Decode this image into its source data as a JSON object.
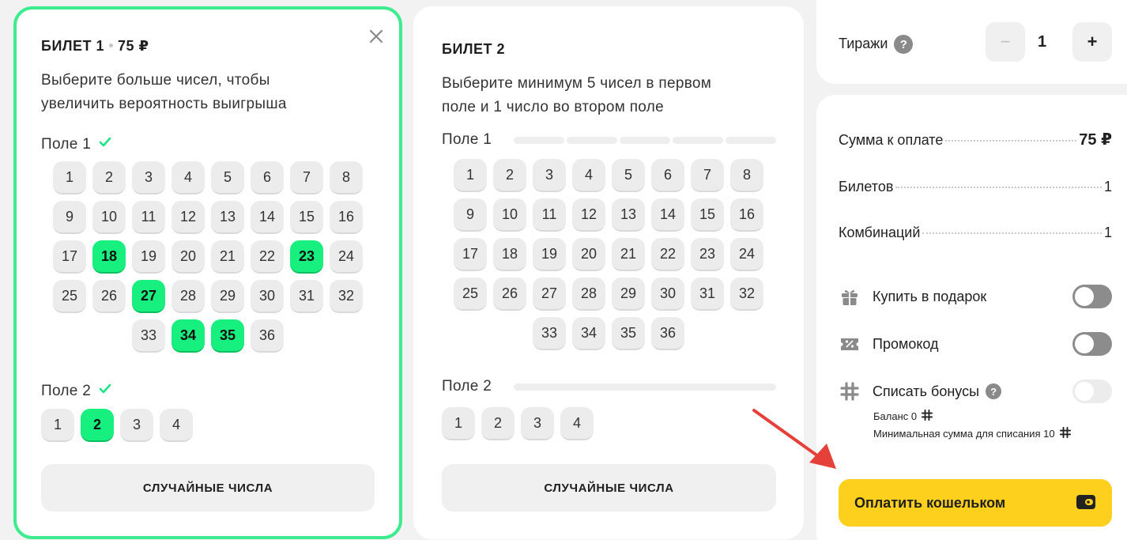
{
  "ticket1": {
    "title": "БИЛЕТ 1",
    "price": "75 ₽",
    "description": "Выберите больше чисел, чтобы увеличить вероятность выигрыша",
    "field1_label": "Поле 1",
    "field2_label": "Поле 2",
    "field1_numbers": [
      "1",
      "2",
      "3",
      "4",
      "5",
      "6",
      "7",
      "8",
      "9",
      "10",
      "11",
      "12",
      "13",
      "14",
      "15",
      "16",
      "17",
      "18",
      "19",
      "20",
      "21",
      "22",
      "23",
      "24",
      "25",
      "26",
      "27",
      "28",
      "29",
      "30",
      "31",
      "32",
      "33",
      "34",
      "35",
      "36"
    ],
    "field1_selected": [
      "18",
      "23",
      "27",
      "34",
      "35"
    ],
    "field2_numbers": [
      "1",
      "2",
      "3",
      "4"
    ],
    "field2_selected": [
      "2"
    ],
    "random_button": "СЛУЧАЙНЫЕ ЧИСЛА"
  },
  "ticket2": {
    "title": "БИЛЕТ 2",
    "description": "Выберите минимум 5 чисел в первом поле и 1 число во втором поле",
    "field1_label": "Поле 1",
    "field2_label": "Поле 2",
    "field1_numbers": [
      "1",
      "2",
      "3",
      "4",
      "5",
      "6",
      "7",
      "8",
      "9",
      "10",
      "11",
      "12",
      "13",
      "14",
      "15",
      "16",
      "17",
      "18",
      "19",
      "20",
      "21",
      "22",
      "23",
      "24",
      "25",
      "26",
      "27",
      "28",
      "29",
      "30",
      "31",
      "32",
      "33",
      "34",
      "35",
      "36"
    ],
    "field1_selected": [],
    "field2_numbers": [
      "1",
      "2",
      "3",
      "4"
    ],
    "field2_selected": [],
    "random_button": "СЛУЧАЙНЫЕ ЧИСЛА"
  },
  "draws": {
    "label": "Тиражи",
    "help": "?",
    "minus": "−",
    "value": "1",
    "plus": "+"
  },
  "summary": {
    "total_label": "Сумма к оплате",
    "total_value": "75 ₽",
    "tickets_label": "Билетов",
    "tickets_value": "1",
    "combinations_label": "Комбинаций",
    "combinations_value": "1",
    "gift_label": "Купить в подарок",
    "promo_label": "Промокод",
    "bonus_label": "Списать бонусы",
    "bonus_help": "?",
    "balance_text": "Баланс 0",
    "min_sum_text": "Минимальная сумма для списания 10",
    "pay_button": "Оплатить кошельком"
  },
  "colors": {
    "selected": "#17ef7f",
    "accent_border": "#3cec8e",
    "pay_button": "#fcd01c",
    "arrow": "#e5403a"
  }
}
